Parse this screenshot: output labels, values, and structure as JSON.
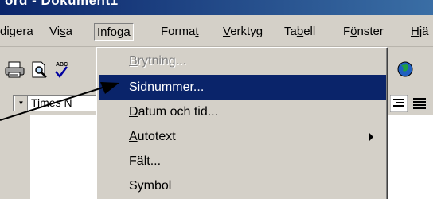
{
  "window": {
    "title": "ord - Dokument1"
  },
  "menubar": {
    "items": [
      {
        "pre": "",
        "ul": "",
        "post": "digera"
      },
      {
        "pre": "Vi",
        "ul": "s",
        "post": "a"
      },
      {
        "pre": "",
        "ul": "I",
        "post": "nfoga"
      },
      {
        "pre": "Forma",
        "ul": "t",
        "post": ""
      },
      {
        "pre": "",
        "ul": "V",
        "post": "erktyg"
      },
      {
        "pre": "Ta",
        "ul": "b",
        "post": "ell"
      },
      {
        "pre": "F",
        "ul": "ö",
        "post": "nster"
      },
      {
        "pre": "",
        "ul": "H",
        "post": "jä"
      }
    ]
  },
  "toolbar": {
    "font_name": "Times N"
  },
  "insert_menu": {
    "items": [
      {
        "pre": "",
        "ul": "B",
        "post": "rytning...",
        "state": "disabled"
      },
      {
        "pre": "",
        "ul": "S",
        "post": "idnummer...",
        "state": "highlighted"
      },
      {
        "pre": "",
        "ul": "D",
        "post": "atum och tid...",
        "state": "normal"
      },
      {
        "pre": "",
        "ul": "A",
        "post": "utotext",
        "state": "normal",
        "submenu": true
      },
      {
        "pre": "F",
        "ul": "ä",
        "post": "lt...",
        "state": "normal"
      },
      {
        "pre": "",
        "ul": "",
        "post": "Symbol",
        "state": "normal"
      }
    ]
  },
  "colors": {
    "highlight": "#0a246a",
    "face": "#d4d0c8"
  }
}
